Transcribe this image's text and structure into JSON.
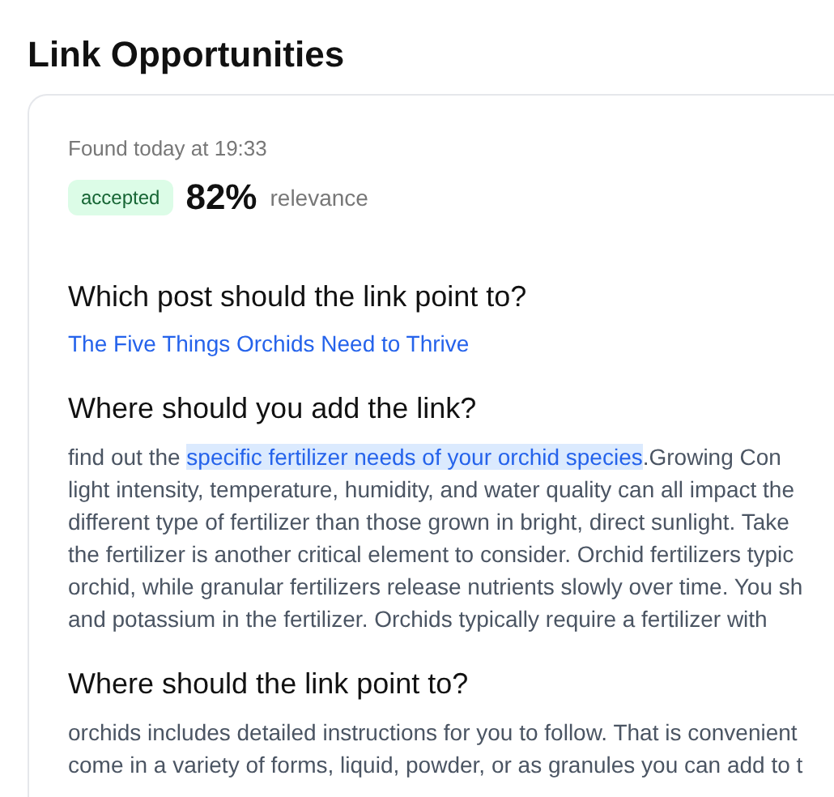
{
  "page_title": "Link Opportunities",
  "card": {
    "found": "Found today at 19:33",
    "badge": {
      "label": "accepted",
      "kind": "success"
    },
    "score": "82%",
    "score_label": "relevance",
    "sections": [
      {
        "kind": "target",
        "heading": "Which post should the link point to?",
        "link": "The Five Things Orchids Need to Thrive"
      },
      {
        "kind": "excerpt",
        "heading": "Where should you add the link?",
        "lines": [
          {
            "kind": "anchored",
            "before": "find out the ",
            "anchor": "specific fertilizer needs of your orchid species",
            "after": ".Growing Con"
          },
          {
            "kind": "text",
            "text": "light intensity, temperature, humidity, and water quality can all impact the"
          },
          {
            "kind": "text",
            "text": "different type of fertilizer than those grown in bright, direct sunlight. Take"
          },
          {
            "kind": "text",
            "text": "the fertilizer is another critical element to consider. Orchid fertilizers typic"
          },
          {
            "kind": "text",
            "text": "orchid, while granular fertilizers release nutrients slowly over time. You sh"
          },
          {
            "kind": "text",
            "text": "and potassium in the fertilizer. Orchids typically require a fertilizer with"
          }
        ]
      },
      {
        "kind": "excerpt",
        "heading": "Where should the link point to?",
        "lines": [
          {
            "kind": "text",
            "text": "orchids includes detailed instructions for you to follow. That is convenient"
          },
          {
            "kind": "text",
            "text": "come in a variety of forms, liquid, powder, or as granules you can add to t"
          }
        ]
      }
    ]
  }
}
